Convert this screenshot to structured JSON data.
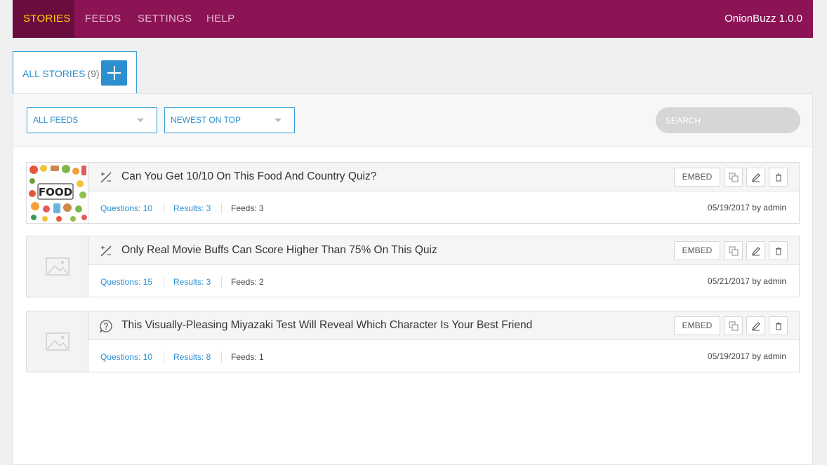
{
  "nav": {
    "items": [
      {
        "label": "STORIES"
      },
      {
        "label": "FEEDS"
      },
      {
        "label": "SETTINGS"
      },
      {
        "label": "HELP"
      }
    ],
    "active": "STORIES",
    "brand": "OnionBuzz 1.0.0"
  },
  "tabs": {
    "all_stories_label": "ALL STORIES",
    "all_stories_count": "(9)",
    "add_icon": "plus-icon"
  },
  "filters": {
    "feed_select": "ALL FEEDS",
    "sort_select": "NEWEST ON TOP",
    "search_placeholder": "SEARCH"
  },
  "colors": {
    "nav_bg": "#8c1455",
    "nav_active_bg": "#6b0c3f",
    "nav_active_text": "#ffd400",
    "accent": "#2d8fd0"
  },
  "stories": [
    {
      "title": "Can You Get 10/10 On This Food And Country Quiz?",
      "type_icon": "percent-icon",
      "thumbnail": "food-image",
      "questions": "Questions: 10",
      "results": "Results: 3",
      "feeds": "Feeds: 3",
      "date": "05/19/2017 by admin",
      "embed_label": "EMBED"
    },
    {
      "title": "Only Real Movie Buffs Can Score Higher Than 75% On This Quiz",
      "type_icon": "percent-icon",
      "thumbnail": "placeholder-image",
      "questions": "Questions: 15",
      "results": "Results: 3",
      "feeds": "Feeds: 2",
      "date": "05/21/2017 by admin",
      "embed_label": "EMBED"
    },
    {
      "title": "This Visually-Pleasing Miyazaki Test Will Reveal Which Character Is Your Best Friend",
      "type_icon": "question-bubble-icon",
      "thumbnail": "placeholder-image",
      "questions": "Questions: 10",
      "results": "Results: 8",
      "feeds": "Feeds: 1",
      "date": "05/19/2017 by admin",
      "embed_label": "EMBED"
    }
  ]
}
